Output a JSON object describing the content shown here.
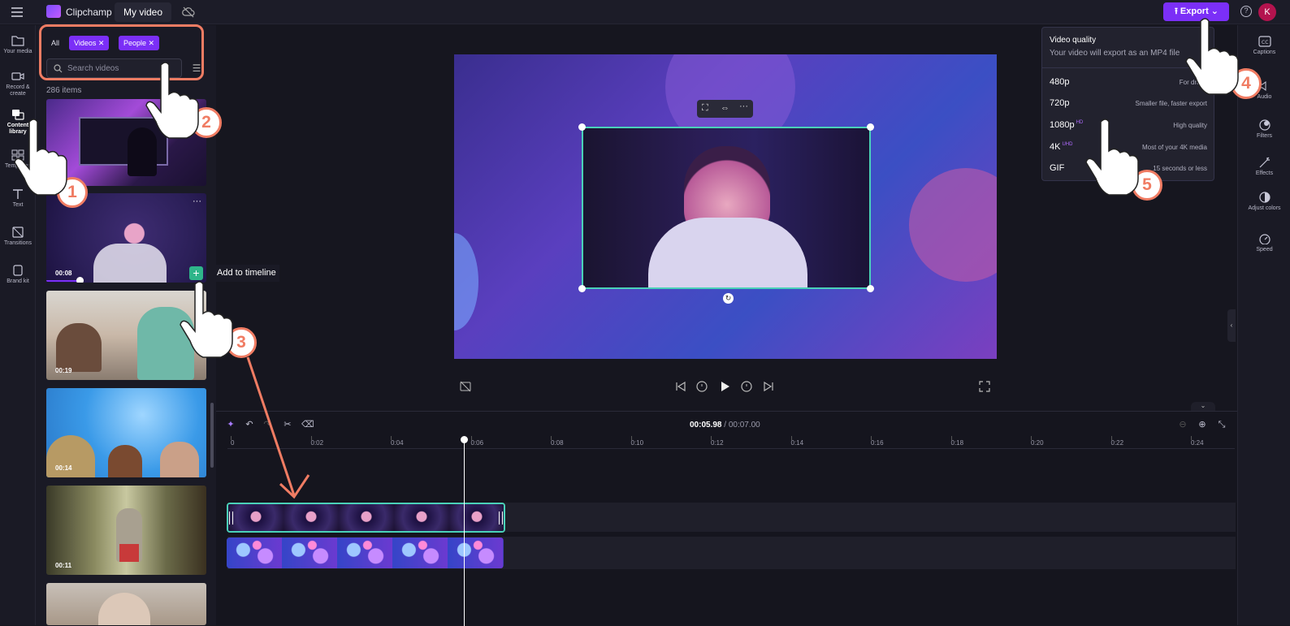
{
  "app": {
    "name": "Clipchamp",
    "project_title": "My video",
    "avatar_letter": "K"
  },
  "toolbar": {
    "export_label": "Export",
    "help_label": "?"
  },
  "rail": {
    "items": [
      {
        "label": "Your media"
      },
      {
        "label": "Record & create"
      },
      {
        "label": "Content library"
      },
      {
        "label": "Templates"
      },
      {
        "label": "Text"
      },
      {
        "label": "Transitions"
      },
      {
        "label": "Brand kit"
      }
    ]
  },
  "library": {
    "filters": [
      "All",
      "Videos",
      "People"
    ],
    "search_placeholder": "Search videos",
    "count": "286 items",
    "thumbs": [
      {
        "duration": ""
      },
      {
        "duration": "00:08"
      },
      {
        "duration": "00:19"
      },
      {
        "duration": "00:14"
      },
      {
        "duration": "00:11"
      },
      {
        "duration": ""
      }
    ],
    "add_tooltip": "Add to timeline"
  },
  "export_menu": {
    "title": "Video quality",
    "subtitle": "Your video will export as an MP4 file",
    "options": [
      {
        "name": "480p",
        "tag": "",
        "desc": "For drafts"
      },
      {
        "name": "720p",
        "tag": "",
        "desc": "Smaller file, faster export"
      },
      {
        "name": "1080p",
        "tag": "HD",
        "desc": "High quality"
      },
      {
        "name": "4K",
        "tag": "UHD",
        "desc": "Most of your 4K media"
      },
      {
        "name": "GIF",
        "tag": "",
        "desc": "15 seconds or less"
      }
    ]
  },
  "right_panel": {
    "items": [
      {
        "label": "Captions"
      },
      {
        "label": "Audio"
      },
      {
        "label": "Filters"
      },
      {
        "label": "Effects"
      },
      {
        "label": "Adjust colors"
      },
      {
        "label": "Speed"
      }
    ]
  },
  "timeline": {
    "current": "00:05.98",
    "total": "/ 00:07.00",
    "ticks": [
      "0",
      "0:02",
      "0:04",
      "0:06",
      "0:08",
      "0:10",
      "0:12",
      "0:14",
      "0:16",
      "0:18",
      "0:20",
      "0:22",
      "0:24"
    ]
  },
  "annotations": {
    "badges": [
      "1",
      "2",
      "3",
      "4",
      "5"
    ]
  },
  "colors": {
    "accent": "#7b2ff7",
    "selection": "#4ad1b8",
    "annotation": "#f07c63"
  }
}
